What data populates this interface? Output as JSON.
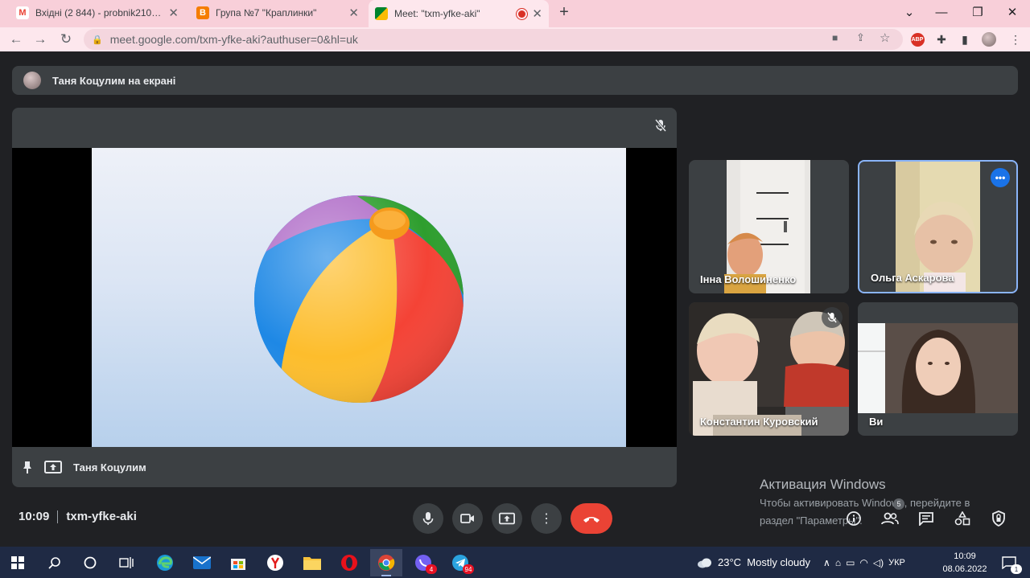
{
  "browser": {
    "tabs": [
      {
        "title": "Вхідні (2 844) - probnik21092018",
        "favicon": "gmail-icon",
        "color": "#ea4335"
      },
      {
        "title": "Група №7 \"Краплинки\"",
        "favicon": "blogger-icon",
        "color": "#f57d00"
      },
      {
        "title": "Meet: \"txm-yfke-aki\"",
        "favicon": "meet-icon",
        "color": "#00832d",
        "active": true
      }
    ],
    "url": "meet.google.com/txm-yfke-aki?authuser=0&hl=uk",
    "new_tab_symbol": "+",
    "extension_badge": "ABP"
  },
  "meet": {
    "presenting_text": "Таня Коцулим на екрані",
    "stage_footer_name": "Таня Коцулим",
    "participants": [
      {
        "name": "Інна Волошиненко"
      },
      {
        "name": "Ольга Аскарова",
        "highlighted": true
      },
      {
        "name": "Константин Куровский",
        "muted": true
      },
      {
        "name": "Ви"
      }
    ],
    "time": "10:09",
    "meeting_code": "txm-yfke-aki",
    "people_count": "5",
    "accent_color": "#1a73e8",
    "hangup_color": "#ea4335"
  },
  "watermark": {
    "title": "Активация Windows",
    "line1": "Чтобы активировать Windows, перейдите в",
    "line2": "раздел \"Параметры\"."
  },
  "taskbar": {
    "viber_badge": "4",
    "telegram_badge": "94",
    "weather": "23°C  Mostly cloudy",
    "language": "УКР",
    "time": "10:09",
    "date": "08.06.2022",
    "notification_count": "1"
  }
}
